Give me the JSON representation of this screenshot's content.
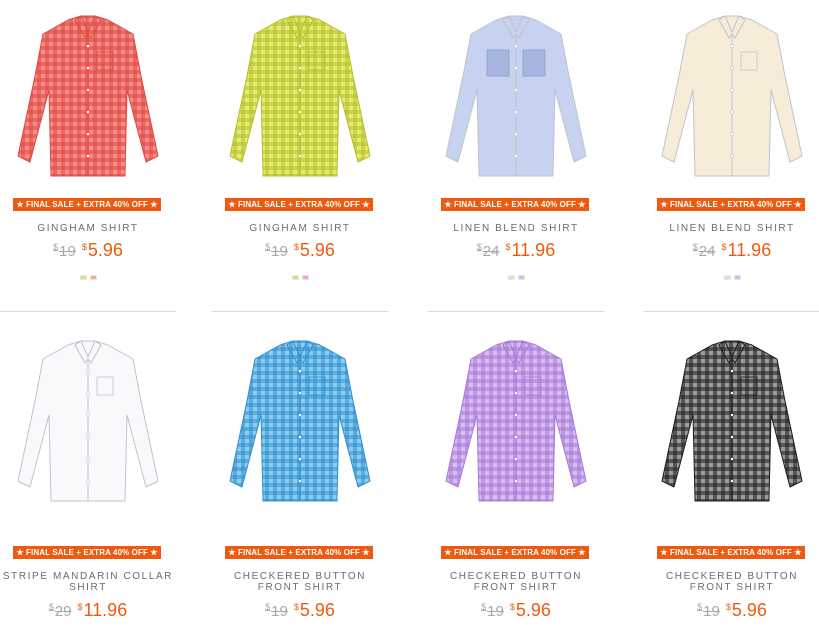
{
  "products": [
    {
      "name": "GINGHAM SHIRT",
      "badge": "★ FINAL SALE + EXTRA 40% OFF ★",
      "old_price": "19",
      "new_price": "5.96",
      "currency": "$",
      "shirt_color": "#f58f8c",
      "grid_color": "#e2473f",
      "pattern": "gingham",
      "swatches": [
        "#d6e07c",
        "#f4a6a4"
      ]
    },
    {
      "name": "GINGHAM SHIRT",
      "badge": "★ FINAL SALE + EXTRA 40% OFF ★",
      "old_price": "19",
      "new_price": "5.96",
      "currency": "$",
      "shirt_color": "#e7ea73",
      "grid_color": "#b4c12c",
      "pattern": "gingham",
      "swatches": [
        "#d6e07c",
        "#f4a6a4"
      ]
    },
    {
      "name": "LINEN BLEND SHIRT",
      "badge": "★ FINAL SALE + EXTRA 40% OFF ★",
      "old_price": "24",
      "new_price": "11.96",
      "currency": "$",
      "shirt_color": "#c6d2ef",
      "grid_color": "#a7b6e0",
      "pattern": "pocket-stripe",
      "swatches": [
        "#efdcc5",
        "#b9c5ea"
      ]
    },
    {
      "name": "LINEN BLEND SHIRT",
      "badge": "★ FINAL SALE + EXTRA 40% OFF ★",
      "old_price": "24",
      "new_price": "11.96",
      "currency": "$",
      "shirt_color": "#f6ecd8",
      "grid_color": "#e8dcc2",
      "pattern": "plain",
      "swatches": [
        "#efdcc5",
        "#b9c5ea"
      ]
    },
    {
      "name": "STRIPE MANDARIN COLLAR SHIRT",
      "badge": "★ FINAL SALE + EXTRA 40% OFF ★",
      "old_price": "29",
      "new_price": "11.96",
      "currency": "$",
      "shirt_color": "#f9f9fb",
      "grid_color": "#d5d7de",
      "pattern": "plain",
      "swatches": []
    },
    {
      "name": "CHECKERED BUTTON FRONT SHIRT",
      "badge": "★ FINAL SALE + EXTRA 40% OFF ★",
      "old_price": "19",
      "new_price": "5.96",
      "currency": "$",
      "shirt_color": "#8fcdf0",
      "grid_color": "#2f8fcf",
      "pattern": "gingham",
      "swatches": []
    },
    {
      "name": "CHECKERED BUTTON FRONT SHIRT",
      "badge": "★ FINAL SALE + EXTRA 40% OFF ★",
      "old_price": "19",
      "new_price": "5.96",
      "currency": "$",
      "shirt_color": "#d8bff0",
      "grid_color": "#a979d8",
      "pattern": "gingham",
      "swatches": []
    },
    {
      "name": "CHECKERED BUTTON FRONT SHIRT",
      "badge": "★ FINAL SALE + EXTRA 40% OFF ★",
      "old_price": "19",
      "new_price": "5.96",
      "currency": "$",
      "shirt_color": "#9a9a9a",
      "grid_color": "#1f1f1f",
      "pattern": "gingham",
      "swatches": []
    }
  ]
}
